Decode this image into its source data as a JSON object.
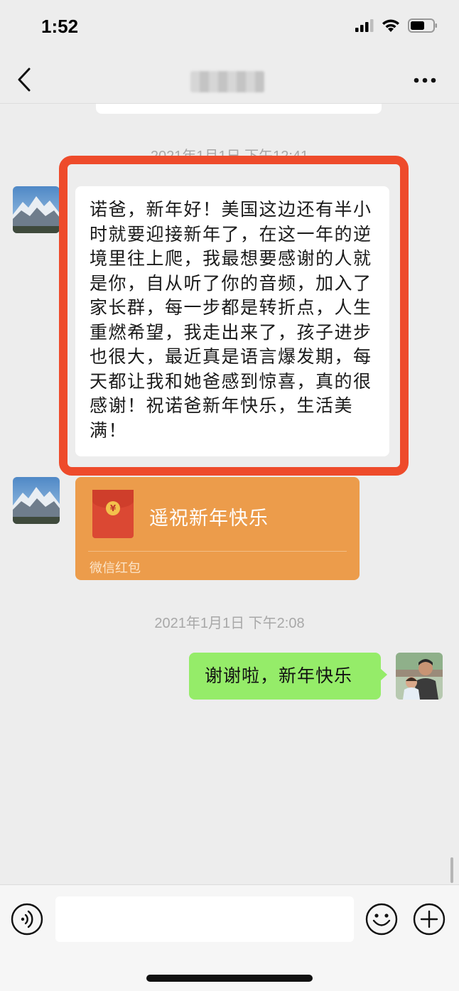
{
  "status_bar": {
    "time": "1:52",
    "icons": [
      "cellular-signal-icon",
      "wifi-icon",
      "battery-icon"
    ]
  },
  "nav": {
    "back_icon": "chevron-left-icon",
    "title_blurred": true,
    "more_icon": "ellipsis-icon"
  },
  "messages": [
    {
      "timestamp": "2021年1月1日 下午12:41",
      "from": "contact",
      "avatar": "mountain-landscape-avatar",
      "text": "诺爸，新年好！美国这边还有半小时就要迎接新年了，在这一年的逆境里往上爬，我最想要感谢的人就是你，自从听了你的音频，加入了家长群，每一步都是转折点，人生重燃希望，我走出来了，孩子进步也很大，最近真是语言爆发期，每天都让我和她爸感到惊喜，真的很感谢！祝诺爸新年快乐，生活美满！",
      "highlighted": true
    },
    {
      "from": "contact",
      "type": "red_packet",
      "title": "遥祝新年快乐",
      "label": "微信红包",
      "coin_symbol": "¥"
    },
    {
      "timestamp": "2021年1月1日 下午2:08",
      "from": "self",
      "avatar": "father-and-child-avatar",
      "text": "谢谢啦，新年快乐"
    }
  ],
  "input_bar": {
    "voice_icon": "voice-input-icon",
    "input_value": "",
    "emoji_icon": "emoji-icon",
    "plus_icon": "plus-icon"
  },
  "colors": {
    "background": "#ededed",
    "highlight": "#ee4b2b",
    "red_packet": "#ec9c4b",
    "self_bubble": "#95ec69"
  }
}
